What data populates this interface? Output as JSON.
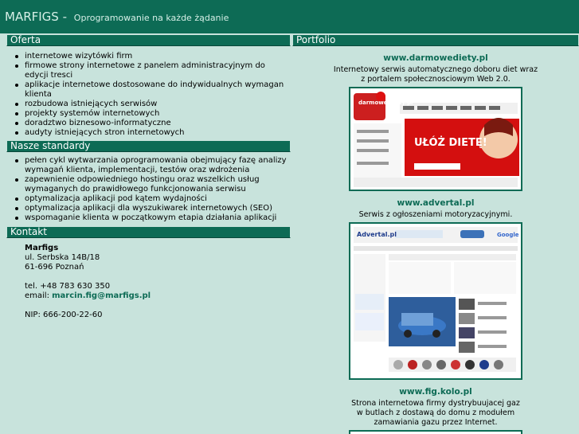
{
  "header": {
    "brand": "MARFIGS -",
    "tagline": "Oprogramowanie na każde żądanie"
  },
  "offer": {
    "title": "Oferta",
    "items": [
      "internetowe wizytówki firm",
      "firmowe strony internetowe z panelem administracyjnym do edycji tresci",
      "aplikacje internetowe dostosowane do indywidualnych wymagan klienta",
      "rozbudowa istniejących serwisów",
      "projekty systemów internetowych",
      "doradztwo biznesowo-informatyczne",
      "audyty istniejących stron internetowych"
    ]
  },
  "standards": {
    "title": "Nasze standardy",
    "items": [
      "pełen cykl wytwarzania oprogramowania obejmujący fazę analizy wymagań klienta, implementacji, testów oraz wdrożenia",
      "zapewnienie odpowiedniego hostingu oraz wszelkich usług wymaganych do prawidłowego funkcjonowania serwisu",
      "optymalizacja aplikacji pod kątem wydajności",
      "optymalizacja aplikacji dla wyszukiwarek internetowych (SEO)",
      "wspomaganie klienta w początkowym etapia działania aplikacji"
    ]
  },
  "contact": {
    "title": "Kontakt",
    "company": "Marfigs",
    "street": "ul. Serbska 14B/18",
    "city": "61-696 Poznań",
    "phone": "tel. +48 783 630 350",
    "email_label": "email:",
    "email": "marcin.fig@marfigs.pl",
    "nip": "NIP: 666-200-22-60"
  },
  "portfolio": {
    "title": "Portfolio",
    "items": [
      {
        "url": "www.darmowediety.pl",
        "desc_line1": "Internetowy serwis automatycznego doboru diet wraz",
        "desc_line2": "z portalem społecznosciowym Web 2.0.",
        "logo": "darmowe diety.pl",
        "banner": "UŁÓŻ DIETĘ!"
      },
      {
        "url": "www.advertal.pl",
        "desc_line1": "Serwis z ogłoszeniami motoryzacyjnymi.",
        "desc_line2": "",
        "logo": "Advertal.pl"
      },
      {
        "url": "www.fig.kolo.pl",
        "desc_line1": "Strona internetowa firmy dystrybuujacej gaz",
        "desc_line2": "w butlach z dostawą do domu z modułem",
        "desc_line3": "zamawiania gazu przez Internet."
      }
    ]
  },
  "colors": {
    "primary": "#0d6b55",
    "background": "#c8e3dc",
    "header_text": "#d6efe7"
  }
}
